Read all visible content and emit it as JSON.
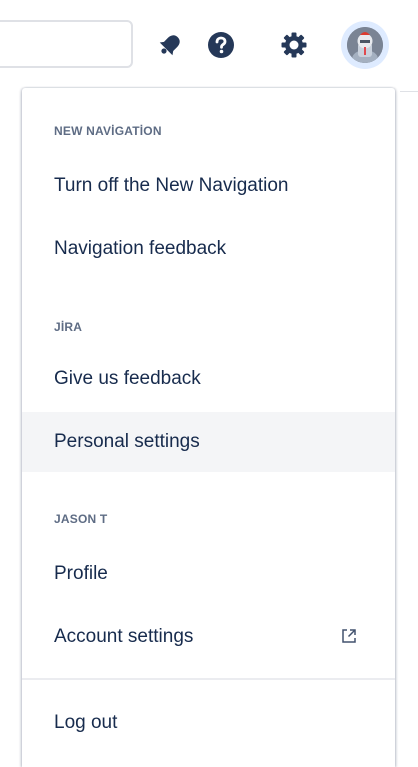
{
  "header": {
    "search": {
      "value": "",
      "placeholder": ""
    },
    "icons": {
      "notifications": "bell-icon",
      "help": "question-circle-icon",
      "settings": "gear-icon",
      "profile": "avatar"
    }
  },
  "menu": {
    "sections": [
      {
        "heading": "NEW NAVİGATİON",
        "items": [
          {
            "label": "Turn off the New Navigation"
          },
          {
            "label": "Navigation feedback"
          }
        ]
      },
      {
        "heading": "JİRA",
        "items": [
          {
            "label": "Give us feedback"
          },
          {
            "label": "Personal settings",
            "hovered": true
          }
        ]
      },
      {
        "heading": "JASON T",
        "items": [
          {
            "label": "Profile"
          },
          {
            "label": "Account settings",
            "icon": "external-link-icon"
          }
        ]
      }
    ],
    "footer": {
      "label": "Log out"
    }
  },
  "colors": {
    "text": "#172b4d",
    "heading": "#5e6c84",
    "icon": "#253858",
    "hover": "#f4f5f7",
    "avatar_ring": "#deebff"
  }
}
